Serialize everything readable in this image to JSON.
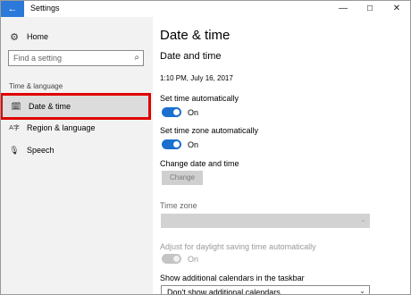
{
  "window": {
    "title": "Settings",
    "back_icon": "←",
    "minimize_icon": "—",
    "maximize_icon": "☐",
    "close_icon": "✕"
  },
  "sidebar": {
    "home": {
      "label": "Home",
      "icon": "⚙"
    },
    "search": {
      "placeholder": "Find a setting",
      "icon": "⌕"
    },
    "section_label": "Time & language",
    "items": [
      {
        "label": "Date & time",
        "icon": "🗓",
        "selected": true
      },
      {
        "label": "Region & language",
        "icon": "A字"
      },
      {
        "label": "Speech",
        "icon": "🎙"
      }
    ],
    "highlight_color": "#e00000"
  },
  "main": {
    "page_title": "Date & time",
    "section_title": "Date and time",
    "current_time": "1:10 PM, July 16, 2017",
    "set_time_auto": {
      "label": "Set time automatically",
      "state": "On",
      "on": true
    },
    "set_timezone_auto": {
      "label": "Set time zone automatically",
      "state": "On",
      "on": true
    },
    "change_date_time": {
      "label": "Change date and time",
      "button": "Change"
    },
    "time_zone": {
      "label": "Time zone",
      "value": ""
    },
    "daylight_saving": {
      "label": "Adjust for daylight saving time automatically",
      "state": "On",
      "disabled": true
    },
    "calendars": {
      "label": "Show additional calendars in the taskbar",
      "value": "Don't show additional calendars"
    }
  },
  "colors": {
    "accent": "#1a6fd1",
    "titlebar_back": "#2b79d8"
  }
}
